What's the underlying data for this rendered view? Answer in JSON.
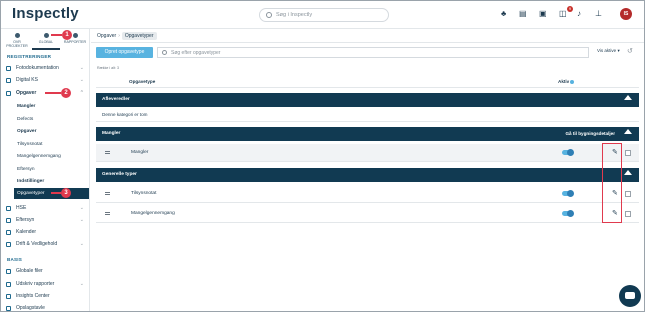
{
  "topbar": {
    "logo": "Inspectly",
    "search_placeholder": "Søg i Inspectly",
    "notification_count": "9",
    "avatar_initials": "IS"
  },
  "subnav": [
    {
      "label": "OVR PROJEKTER"
    },
    {
      "label": "GLOBAL"
    },
    {
      "label": "RAPPORTER"
    }
  ],
  "sidebar": {
    "section_registreringer": "REGISTRERINGER",
    "items": [
      {
        "label": "Fotodokumentation"
      },
      {
        "label": "Digital KS"
      },
      {
        "label": "Opgaver"
      }
    ],
    "opgaver_sub": [
      {
        "label": "Mangler",
        "bold": true
      },
      {
        "label": "Defects",
        "bold": false
      },
      {
        "label": "Opgaver",
        "bold": true
      },
      {
        "label": "Tilsynsnotat",
        "bold": false
      },
      {
        "label": "Mangelgennemgang",
        "bold": false
      },
      {
        "label": "Eftersyn",
        "bold": false
      },
      {
        "label": "Indstillinger",
        "bold": true
      },
      {
        "label": "Opgavetyper",
        "bold": false,
        "selected": true
      }
    ],
    "items_after": [
      {
        "label": "HSE"
      },
      {
        "label": "Eftersyn"
      },
      {
        "label": "Kalender"
      },
      {
        "label": "Drift & Vedligehold"
      }
    ],
    "section_basis": "BASIS",
    "basis_items": [
      {
        "label": "Globale filer"
      },
      {
        "label": "Udskriv rapporter"
      },
      {
        "label": "Insights Center"
      },
      {
        "label": "Opslagstavle"
      }
    ]
  },
  "annotations": {
    "one": "1",
    "two": "2",
    "three": "3"
  },
  "main": {
    "breadcrumb": {
      "root": "Opgaver",
      "current": "Opgavetyper"
    },
    "create_button": "Opret opgavetype",
    "filter_placeholder": "Søg efter opgavetyper",
    "filter_select": "Vis aktive",
    "count_text": "Række i alt: 3",
    "columns": {
      "type": "Opgavetype",
      "active": "Aktiv"
    },
    "groups": [
      {
        "name": "Afleveredler",
        "right": "",
        "empty": "Denne kategori er tom",
        "rows": []
      },
      {
        "name": "Mangler",
        "right": "Gå til bygningsdetaljer",
        "rows": [
          {
            "label": "Mangler",
            "active": true
          }
        ]
      },
      {
        "name": "Generelle typer",
        "right": "",
        "rows": [
          {
            "label": "Tilsynsnotat",
            "active": true
          },
          {
            "label": "Mangelgennemgang",
            "active": true
          }
        ]
      }
    ]
  },
  "colors": {
    "primary": "#113a52",
    "accent": "#58b3e0",
    "annotation": "#e03a4e"
  }
}
